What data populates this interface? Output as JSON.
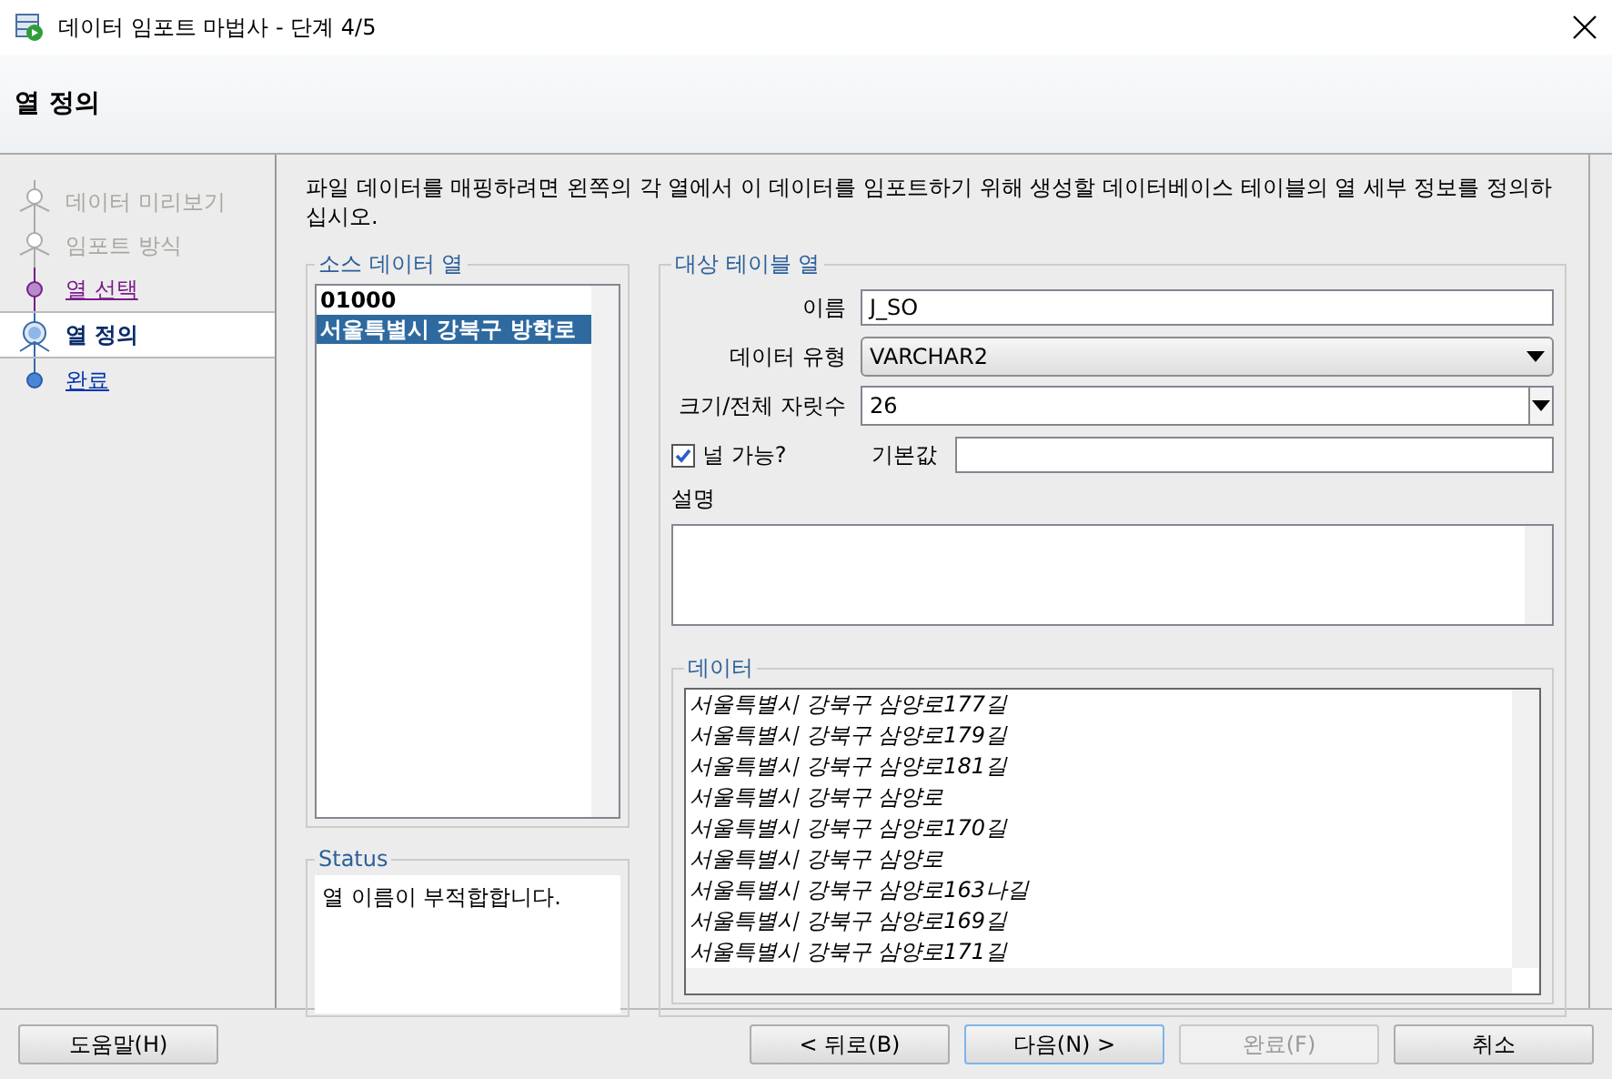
{
  "window": {
    "title": "데이터 임포트 마법사 - 단계 4/5"
  },
  "header": {
    "title": "열 정의"
  },
  "steps": [
    {
      "label": "데이터 미리보기",
      "disabled": true,
      "visited": false,
      "selected": false
    },
    {
      "label": "임포트 방식",
      "disabled": true,
      "visited": false,
      "selected": false
    },
    {
      "label": "열 선택",
      "disabled": false,
      "visited": true,
      "selected": false
    },
    {
      "label": "열 정의",
      "disabled": false,
      "visited": false,
      "selected": true
    },
    {
      "label": "완료",
      "disabled": false,
      "visited": false,
      "selected": false
    }
  ],
  "description": "파일 데이터를 매핑하려면 왼쪽의 각 열에서 이 데이터를 임포트하기 위해 생성할 데이터베이스 테이블의 열 세부 정보를 정의하십시오.",
  "source_columns": {
    "title": "소스 데이터 열",
    "items": [
      {
        "label": "01000",
        "selected": false
      },
      {
        "label": "서울특별시 강북구 방학로",
        "selected": true
      }
    ]
  },
  "status": {
    "title": "Status",
    "message": "열 이름이 부적합합니다."
  },
  "target": {
    "title": "대상 테이블 열",
    "name_label": "이름",
    "name_value": "J_SO",
    "type_label": "데이터 유형",
    "type_value": "VARCHAR2",
    "size_label": "크기/전체 자릿수",
    "size_value": "26",
    "nullable_label": "널 가능?",
    "nullable_checked": true,
    "default_label": "기본값",
    "description_label": "설명"
  },
  "data": {
    "title": "데이터",
    "rows": [
      "서울특별시 강북구 삼양로177길",
      "서울특별시 강북구 삼양로179길",
      "서울특별시 강북구 삼양로181길",
      "서울특별시 강북구 삼양로",
      "서울특별시 강북구 삼양로170길",
      "서울특별시 강북구 삼양로",
      "서울특별시 강북구 삼양로163나길",
      "서울특별시 강북구 삼양로169길",
      "서울특별시 강북구 삼양로171길"
    ]
  },
  "buttons": [
    {
      "label": "도움말(H)",
      "kind": "left",
      "disabled": false,
      "default": false
    },
    {
      "label": "< 뒤로(B)",
      "kind": "right",
      "disabled": false,
      "default": false
    },
    {
      "label": "다음(N) >",
      "kind": "right",
      "disabled": false,
      "default": true
    },
    {
      "label": "완료(F)",
      "kind": "right",
      "disabled": true,
      "default": false
    },
    {
      "label": "취소",
      "kind": "right",
      "disabled": false,
      "default": false
    }
  ]
}
